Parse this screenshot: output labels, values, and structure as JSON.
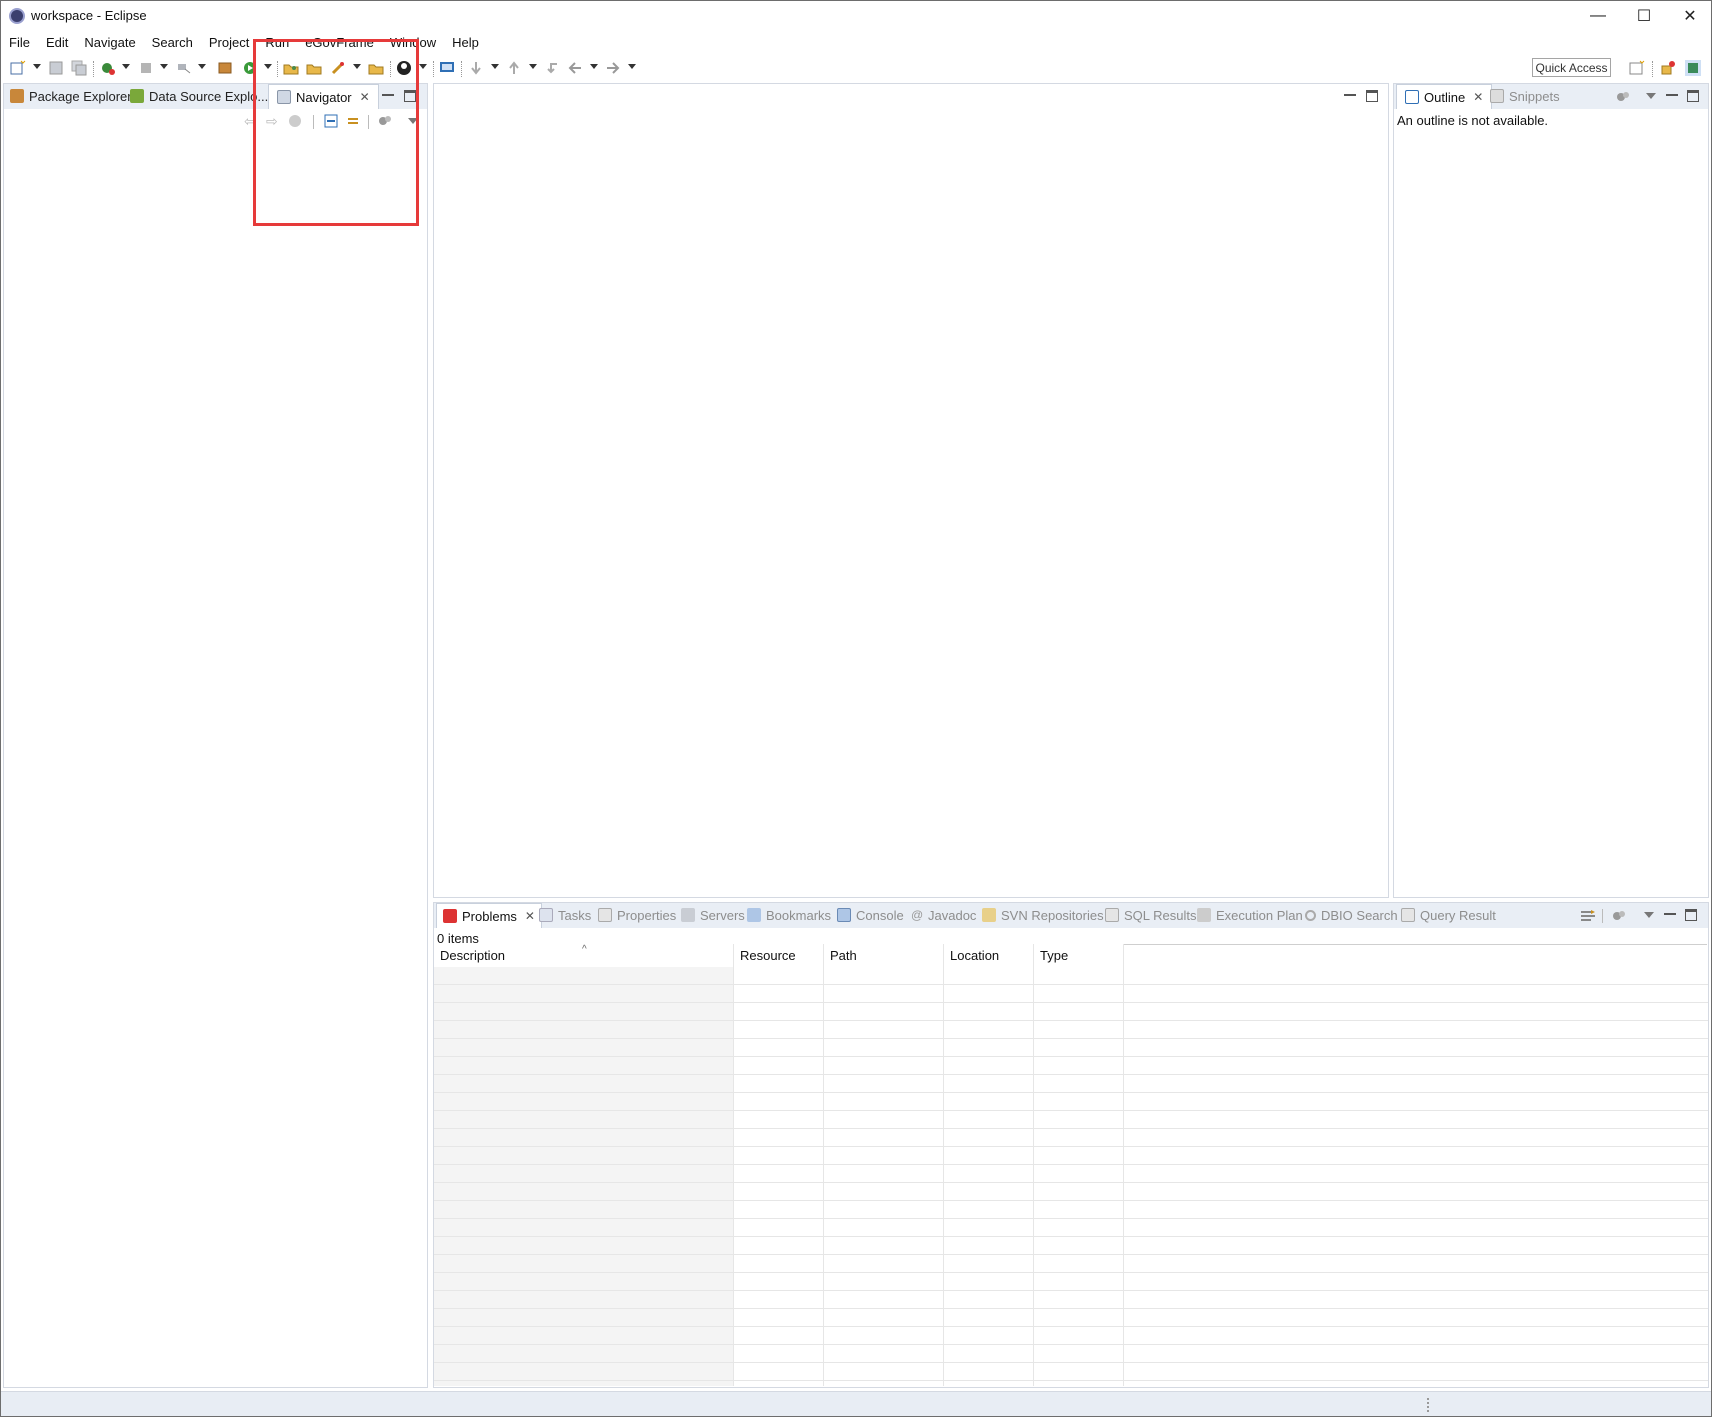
{
  "window": {
    "title": "workspace - Eclipse",
    "controls": {
      "minimize": "—",
      "maximize": "☐",
      "close": "✕"
    }
  },
  "menubar": [
    "File",
    "Edit",
    "Navigate",
    "Search",
    "Project",
    "Run",
    "eGovFrame",
    "Window",
    "Help"
  ],
  "toolbar": {
    "quick_access": "Quick Access"
  },
  "left_panel": {
    "tabs": [
      {
        "label": "Package Explorer",
        "icon": "package-explorer-icon",
        "active": false
      },
      {
        "label": "Data Source Explo...",
        "icon": "data-source-icon",
        "active": false
      },
      {
        "label": "Navigator",
        "icon": "navigator-icon",
        "active": true
      }
    ]
  },
  "outline_panel": {
    "tabs": [
      {
        "label": "Outline",
        "icon": "outline-icon",
        "active": true
      },
      {
        "label": "Snippets",
        "icon": "snippets-icon",
        "active": false
      }
    ],
    "message": "An outline is not available."
  },
  "bottom_panel": {
    "tabs": [
      {
        "label": "Problems",
        "icon": "problems-icon",
        "active": true
      },
      {
        "label": "Tasks",
        "icon": "tasks-icon",
        "active": false
      },
      {
        "label": "Properties",
        "icon": "properties-icon",
        "active": false
      },
      {
        "label": "Servers",
        "icon": "servers-icon",
        "active": false
      },
      {
        "label": "Bookmarks",
        "icon": "bookmarks-icon",
        "active": false
      },
      {
        "label": "Console",
        "icon": "console-icon",
        "active": false
      },
      {
        "label": "Javadoc",
        "icon": "javadoc-icon",
        "active": false
      },
      {
        "label": "SVN Repositories",
        "icon": "svn-icon",
        "active": false
      },
      {
        "label": "SQL Results",
        "icon": "sql-results-icon",
        "active": false
      },
      {
        "label": "Execution Plan",
        "icon": "execution-plan-icon",
        "active": false
      },
      {
        "label": "DBIO Search",
        "icon": "dbio-search-icon",
        "active": false
      },
      {
        "label": "Query Result",
        "icon": "query-result-icon",
        "active": false
      }
    ],
    "item_count": "0 items",
    "columns": [
      "Description",
      "Resource",
      "Path",
      "Location",
      "Type"
    ]
  },
  "colors": {
    "highlight": "#e63a3a",
    "panel_header": "#e9eef5",
    "accent": "#2f6fb5"
  }
}
